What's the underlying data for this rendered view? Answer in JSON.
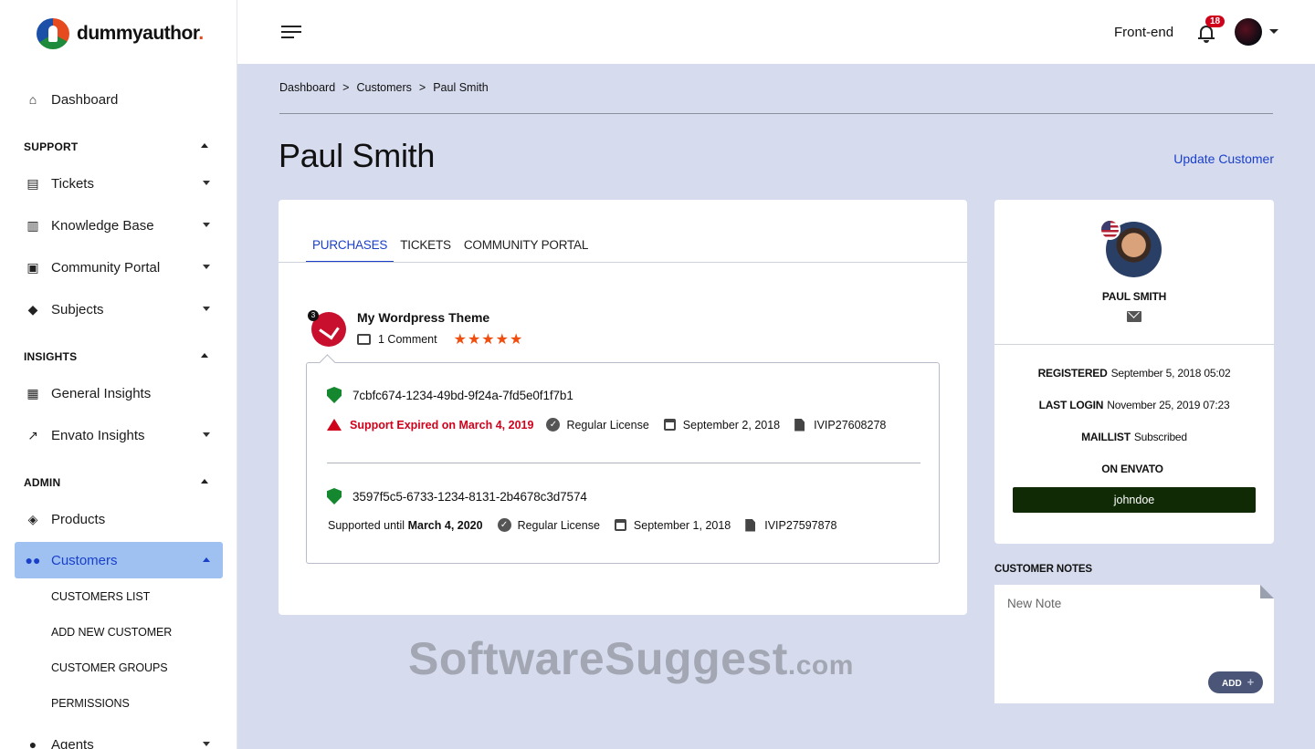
{
  "app": {
    "logo_text": "dummyauthor",
    "logo_dot": "."
  },
  "sidebar": {
    "dashboard": "Dashboard",
    "support": {
      "label": "SUPPORT",
      "items": [
        "Tickets",
        "Knowledge Base",
        "Community Portal",
        "Subjects"
      ]
    },
    "insights": {
      "label": "INSIGHTS",
      "items": [
        "General Insights",
        "Envato Insights"
      ]
    },
    "admin": {
      "label": "ADMIN",
      "products": "Products",
      "customers": "Customers",
      "customer_sub": [
        "CUSTOMERS LIST",
        "ADD NEW CUSTOMER",
        "CUSTOMER GROUPS",
        "PERMISSIONS"
      ],
      "agents": "Agents"
    }
  },
  "topbar": {
    "front_end": "Front-end",
    "notification_count": "18"
  },
  "breadcrumb": [
    "Dashboard",
    "Customers",
    "Paul Smith"
  ],
  "breadcrumb_sep": ">",
  "page": {
    "title": "Paul Smith",
    "update_link": "Update Customer"
  },
  "tabs": [
    "PURCHASES",
    "TICKETS",
    "COMMUNITY PORTAL"
  ],
  "purchase": {
    "badge": "3",
    "title": "My Wordpress Theme",
    "comments": "1 Comment",
    "stars": "★★★★★",
    "rating": 5,
    "licenses": [
      {
        "key": "7cbfc674-1234-49bd-9f24a-7fd5e0f1f7b1",
        "support": "Support Expired on March 4, 2019",
        "license": "Regular License",
        "date": "September 2, 2018",
        "code": "IVIP27608278"
      },
      {
        "key": "3597f5c5-6733-1234-8131-2b4678c3d7574",
        "support_prefix": "Supported until",
        "support_date": "March 4, 2020",
        "license": "Regular License",
        "date": "September 1, 2018",
        "code": "IVIP27597878"
      }
    ]
  },
  "customer": {
    "name": "PAUL SMITH",
    "registered_label": "REGISTERED",
    "registered": "September 5, 2018 05:02",
    "last_login_label": "LAST LOGIN",
    "last_login": "November 25, 2019 07:23",
    "maillist_label": "MAILLIST",
    "maillist": "Subscribed",
    "envato_label": "ON ENVATO",
    "envato_user": "johndoe"
  },
  "notes": {
    "label": "CUSTOMER NOTES",
    "placeholder": "New Note",
    "add_label": "ADD",
    "add_icon": "+"
  },
  "watermark": {
    "main": "SoftwareSuggest",
    "suffix": ".com"
  },
  "colors": {
    "accent": "#1a3fc9",
    "danger": "#d0021b",
    "success": "#15882f",
    "star": "#f04d0e",
    "envato": "#0f2a04"
  }
}
